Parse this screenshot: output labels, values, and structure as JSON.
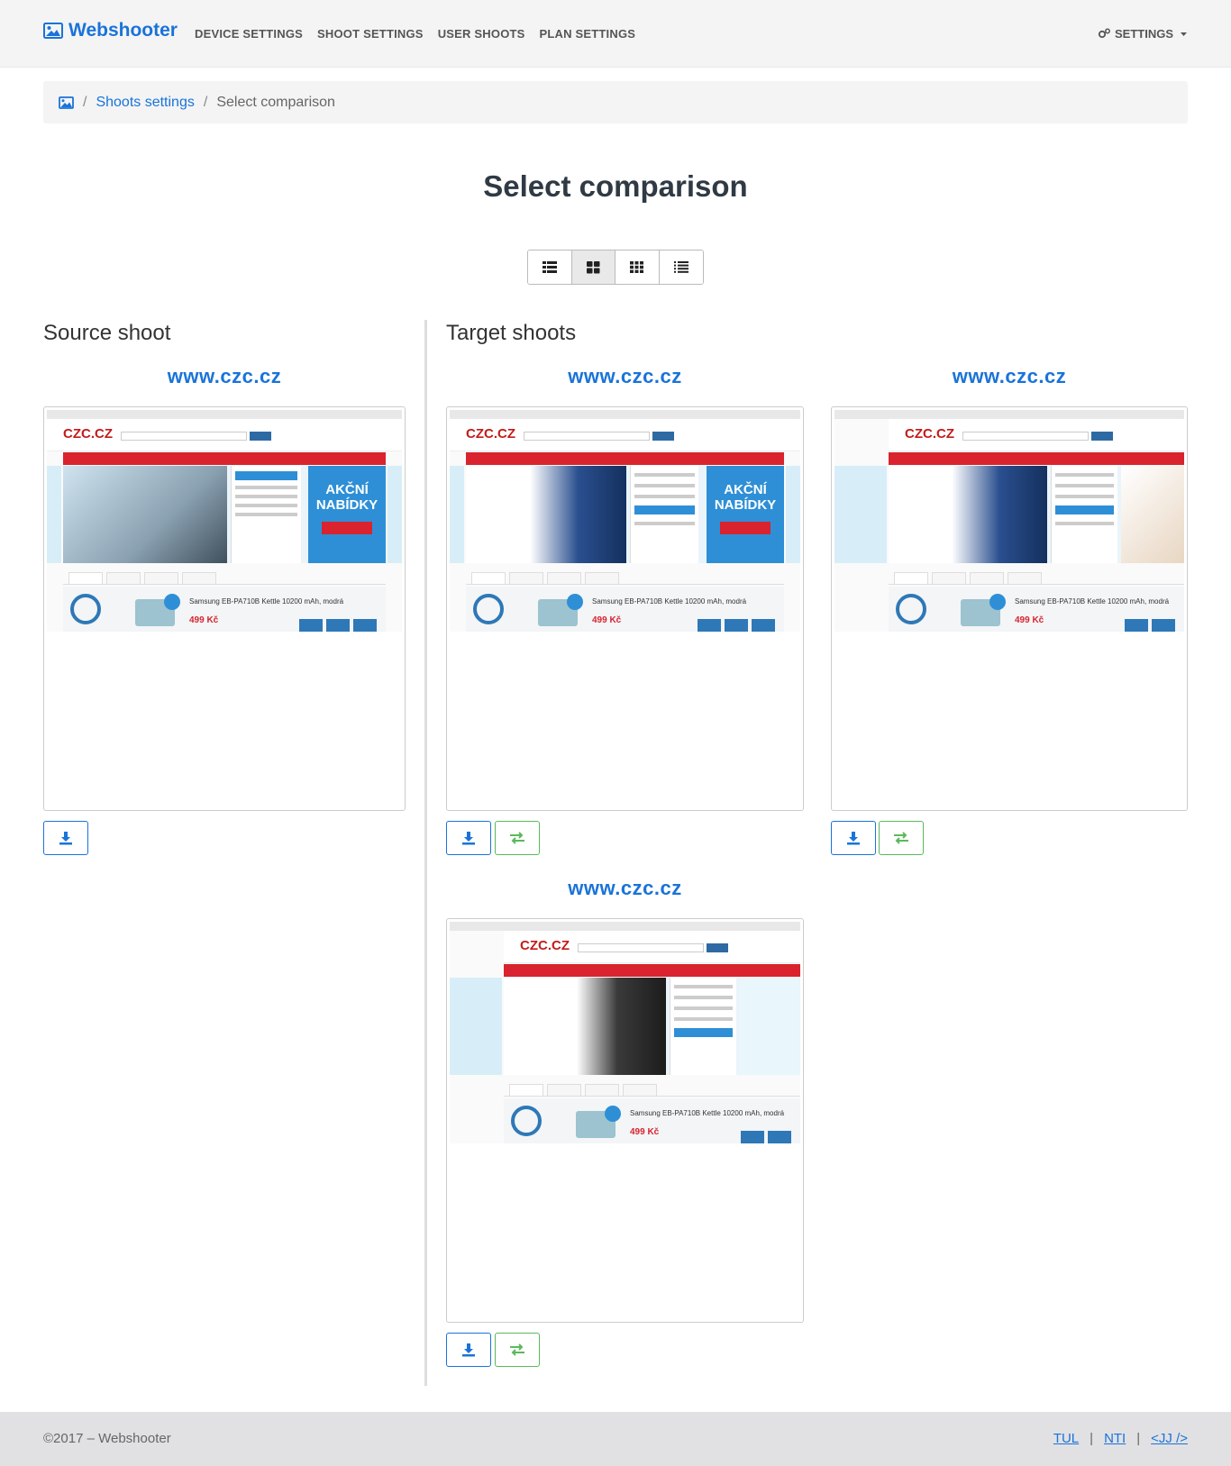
{
  "navbar": {
    "brand": "Webshooter",
    "links": [
      "DEVICE SETTINGS",
      "SHOOT SETTINGS",
      "USER SHOOTS",
      "PLAN SETTINGS"
    ],
    "settings_label": "SETTINGS"
  },
  "breadcrumb": {
    "sep": "/",
    "link": "Shoots settings",
    "current": "Select comparison"
  },
  "page_title": "Select comparison",
  "view_options": [
    "list-view-icon",
    "large-grid-icon",
    "small-grid-icon",
    "detail-list-icon"
  ],
  "source": {
    "heading": "Source shoot",
    "shoot": {
      "label": "www.czc.cz",
      "logo": "CZC.CZ",
      "product": "Samsung EB-PA710B Kettle 10200 mAh, modrá",
      "price": "499 Kč"
    }
  },
  "targets": {
    "heading": "Target shoots",
    "shoots": [
      {
        "label": "www.czc.cz",
        "logo": "CZC.CZ",
        "product": "Samsung EB-PA710B Kettle 10200 mAh, modrá",
        "price": "499 Kč"
      },
      {
        "label": "www.czc.cz",
        "logo": "CZC.CZ",
        "product": "Samsung EB-PA710B Kettle 10200 mAh, modrá",
        "price": "499 Kč"
      },
      {
        "label": "www.czc.cz",
        "logo": "CZC.CZ",
        "product": "Samsung EB-PA710B Kettle 10200 mAh, modrá",
        "price": "499 Kč"
      }
    ]
  },
  "footer": {
    "copyright": "©2017 – Webshooter",
    "links": [
      "TUL",
      "NTI",
      "<JJ />"
    ],
    "sep": "|"
  },
  "colors": {
    "brand": "#1a73d9",
    "compare": "#5cb85c"
  }
}
